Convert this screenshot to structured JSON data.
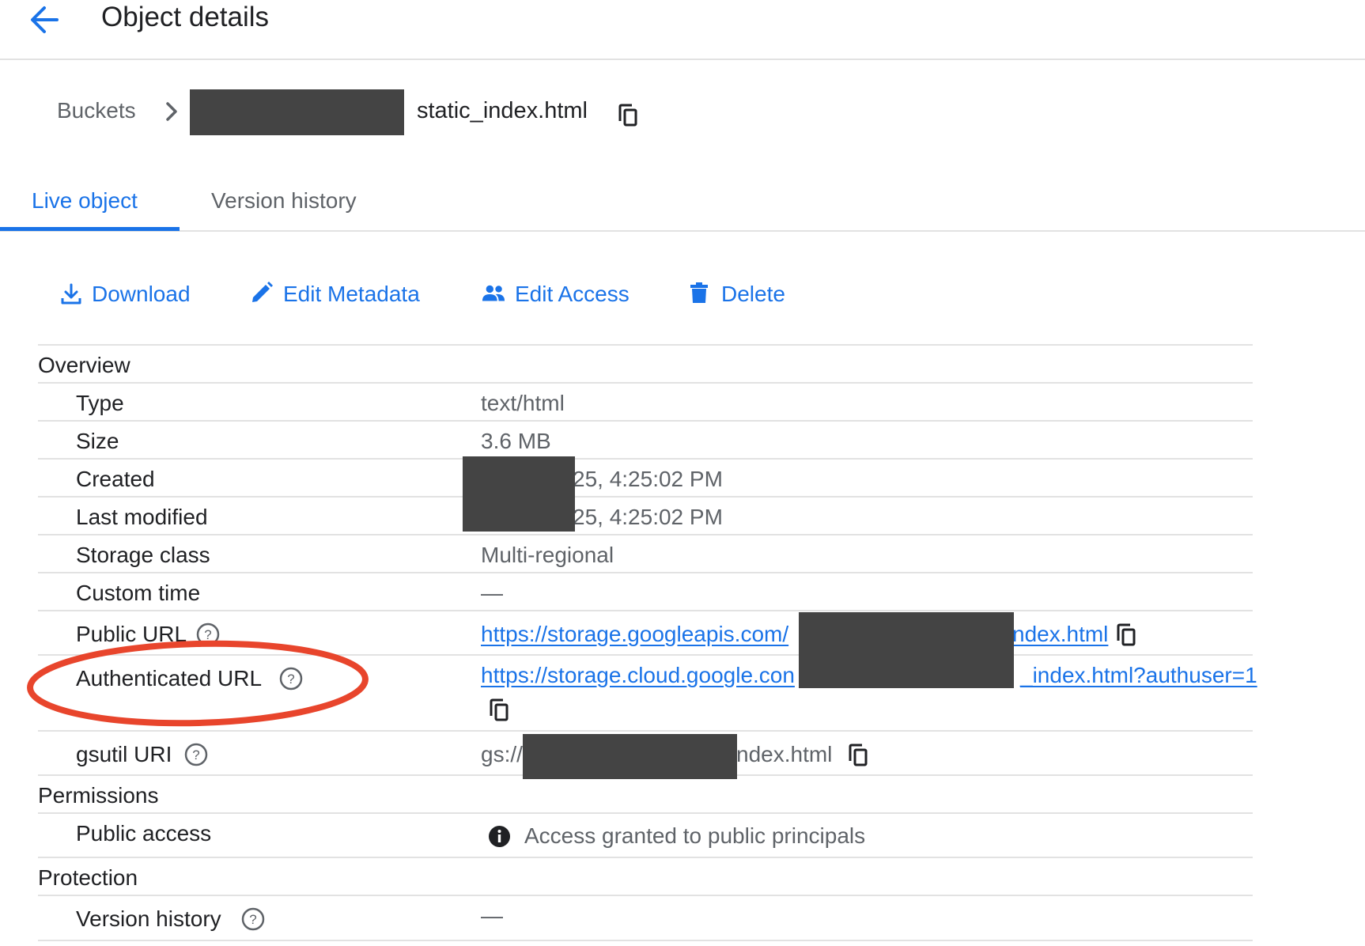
{
  "header": {
    "title": "Object details",
    "back_icon": "arrow-left-icon"
  },
  "breadcrumb": {
    "root": "Buckets",
    "object": "static_index.html"
  },
  "tabs": [
    {
      "label": "Live object",
      "active": true
    },
    {
      "label": "Version history",
      "active": false
    }
  ],
  "actions": [
    {
      "label": "Download",
      "icon": "download-icon"
    },
    {
      "label": "Edit Metadata",
      "icon": "pencil-icon"
    },
    {
      "label": "Edit Access",
      "icon": "people-icon"
    },
    {
      "label": "Delete",
      "icon": "trash-icon"
    }
  ],
  "sections": {
    "overview": "Overview",
    "permissions": "Permissions",
    "protection": "Protection"
  },
  "overview": {
    "type": {
      "label": "Type",
      "value": "text/html"
    },
    "size": {
      "label": "Size",
      "value": "3.6 MB"
    },
    "created": {
      "label": "Created",
      "value": "25, 4:25:02 PM"
    },
    "last_modified": {
      "label": "Last modified",
      "value": "25, 4:25:02 PM"
    },
    "storage_class": {
      "label": "Storage class",
      "value": "Multi-regional"
    },
    "custom_time": {
      "label": "Custom time",
      "value": "—"
    },
    "public_url": {
      "label": "Public URL",
      "prefix": "https://storage.googleapis.com/",
      "suffix": "ndex.html"
    },
    "authenticated_url": {
      "label": "Authenticated URL",
      "prefix": "https://storage.cloud.google.con",
      "suffix": "_index.html?authuser=1"
    },
    "gsutil_uri": {
      "label": "gsutil URI",
      "prefix": "gs://",
      "suffix": "ndex.html"
    }
  },
  "permissions": {
    "public_access": {
      "label": "Public access",
      "value": "Access granted to public principals"
    }
  },
  "protection": {
    "version_history": {
      "label": "Version history",
      "value": "—"
    }
  },
  "colors": {
    "accent": "#1a73e8",
    "annotation": "#e8452c",
    "redaction": "#444444"
  }
}
